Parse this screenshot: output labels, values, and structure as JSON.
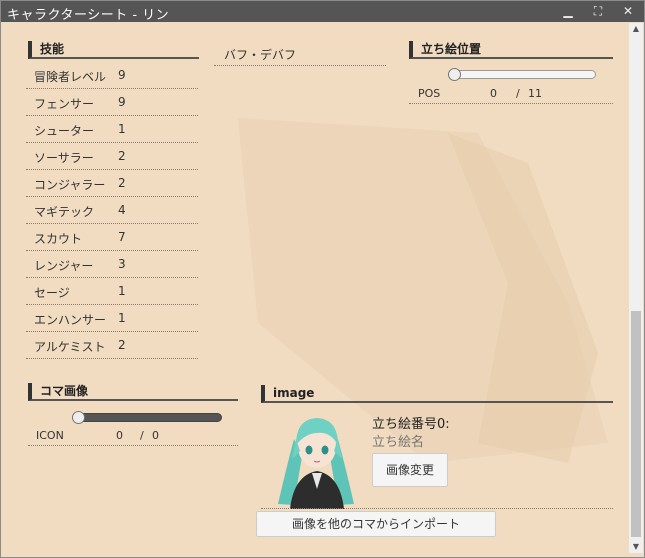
{
  "window": {
    "title": "キャラクターシート - リン"
  },
  "skills": {
    "heading": "技能",
    "items": [
      {
        "name": "冒険者レベル",
        "level": "9"
      },
      {
        "name": "フェンサー",
        "level": "9"
      },
      {
        "name": "シューター",
        "level": "1"
      },
      {
        "name": "ソーサラー",
        "level": "2"
      },
      {
        "name": "コンジャラー",
        "level": "2"
      },
      {
        "name": "マギテック",
        "level": "4"
      },
      {
        "name": "スカウト",
        "level": "7"
      },
      {
        "name": "レンジャー",
        "level": "3"
      },
      {
        "name": "セージ",
        "level": "1"
      },
      {
        "name": "エンハンサー",
        "level": "1"
      },
      {
        "name": "アルケミスト",
        "level": "2"
      }
    ]
  },
  "buff": {
    "label": "バフ・デバフ"
  },
  "standing": {
    "heading": "立ち絵位置",
    "pos_label": "POS",
    "pos_value": "0",
    "separator": "/",
    "pos_max": "11"
  },
  "koma": {
    "heading": "コマ画像",
    "icon_label": "ICON",
    "icon_value": "0",
    "separator": "/",
    "icon_max": "0"
  },
  "image": {
    "heading": "image",
    "number_label": "立ち絵番号0:",
    "name_placeholder": "立ち絵名",
    "change_button": "画像変更",
    "import_button": "画像を他のコマからインポート"
  },
  "colors": {
    "panel": "#f1dcc1",
    "titlebar": "#555555",
    "accent": "#333333"
  }
}
